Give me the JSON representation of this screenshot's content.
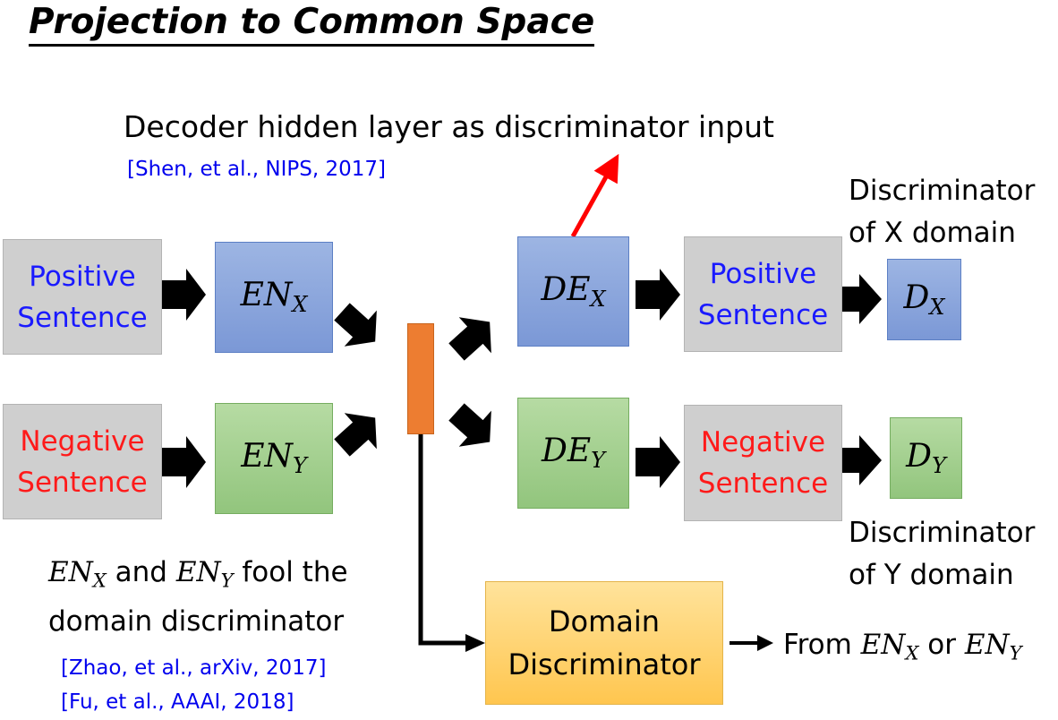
{
  "title": "Projection to Common Space",
  "decoder_note": {
    "text": "Decoder hidden layer as discriminator input",
    "citation": "[Shen, et al., NIPS, 2017]"
  },
  "inputs": {
    "positive": {
      "line1": "Positive",
      "line2": "Sentence"
    },
    "negative": {
      "line1": "Negative",
      "line2": "Sentence"
    }
  },
  "encoders": {
    "x": {
      "base": "EN",
      "sub": "X"
    },
    "y": {
      "base": "EN",
      "sub": "Y"
    }
  },
  "decoders": {
    "x": {
      "base": "DE",
      "sub": "X"
    },
    "y": {
      "base": "DE",
      "sub": "Y"
    }
  },
  "outputs": {
    "positive": {
      "line1": "Positive",
      "line2": "Sentence"
    },
    "negative": {
      "line1": "Negative",
      "line2": "Sentence"
    }
  },
  "discriminators": {
    "x": {
      "base": "D",
      "sub": "X",
      "label_line1": "Discriminator",
      "label_line2": "of X domain"
    },
    "y": {
      "base": "D",
      "sub": "Y",
      "label_line1": "Discriminator",
      "label_line2": "of Y domain"
    }
  },
  "fool_note": {
    "a_base": "EN",
    "a_sub": "X",
    "connector": " and ",
    "b_base": "EN",
    "b_sub": "Y",
    "tail": " fool the",
    "line2": "domain discriminator",
    "citation1": "[Zhao, et al., arXiv, 2017]",
    "citation2": "[Fu, et al., AAAI, 2018]"
  },
  "domain_discriminator": {
    "line1": "Domain",
    "line2": "Discriminator"
  },
  "domain_output": {
    "prefix": "From ",
    "a_base": "EN",
    "a_sub": "X",
    "connector": " or ",
    "b_base": "EN",
    "b_sub": "Y"
  },
  "colors": {
    "positive_text": "#1a1aff",
    "negative_text": "#ff1a1a",
    "citation_text": "#0000ee",
    "latent_box": "#ed7d31",
    "decoder_arrow": "#ff0000"
  }
}
